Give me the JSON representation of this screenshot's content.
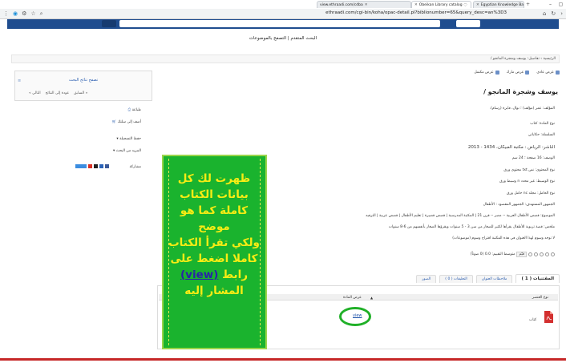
{
  "browser": {
    "tabs": [
      {
        "label": "view.ethraadi.com/cdba"
      },
      {
        "label": "Obeikan Library catalog"
      },
      {
        "label": "Egyptian Knowledge Ba"
      }
    ],
    "url": "ethraadi.com/cgi-bin/koha/opac-detail.pl?biblionumber=65&query_desc=an%3D3"
  },
  "header": {
    "advanced_links": "البحث المتقدم | التصفح بالموضوعات"
  },
  "breadcrumb": "الرئيسية › تفاصيل: يوسف وشجرة المانجو /",
  "toolbar": {
    "normal_view": "عرض عادي",
    "marc_view": "عرض مارك",
    "isbd_view": "عرض مكتمل"
  },
  "record": {
    "title": "يوسف وشجرة المانجو /",
    "author": "المؤلف: عمر (مؤلف) ؛ نوال، فايزة (رسام).",
    "material_type": "نوع المادة: كتاب",
    "series": "السلسلة: حكاياتي",
    "publisher": "الناشر: الرياض : مكتبة العبيكان، 1434 - 2013",
    "description": "الوصف: 16 صفحة ؛ 24 سم",
    "content_type": "نوع المحتوى: نص txt محتوى ورق",
    "media_type": "نوع الوسيط: غير محدد n وسيط ورق",
    "carrier_type": "نوع الحامل: مجلد nc حامل ورق",
    "audience": "الجمهور المستهدف: الجمهور المقصود : الأطفال",
    "subjects": "الموضوع: قصص الأطفال العربية -- مصر -- قرن 21 | المكتبة المدرسية | قصص قصيرة | تعليم الأطفال | قصص عربية | الترفيه",
    "summary": "ملخص: قصة تربوية للأطفال يقرأها لكثير للصغار من سن 3 - 5 سنوات ويقرؤها الصغار بأنفسهم من 6-8 سنوات",
    "tags": "لا توجد وسوم لهذا العنوان في هذه المكتبة   اقتراح وسوم (موضوعات)",
    "rating": "متوسط التقييم: 0.0 (0 صوتاً)",
    "rate_button": "قيّم"
  },
  "tabs": {
    "holdings": "المقتنيات ( 1 )",
    "title_notes": "ملاحظات العنوان",
    "comments": "التعليقات ( 0 )",
    "images": "الصور"
  },
  "holdings_table": {
    "col_item_type": "نوع العنصر",
    "col_material_view": "عرض المادة",
    "sort_marker": "▲",
    "rows": [
      {
        "item_type": "كتاب",
        "view": "view"
      }
    ]
  },
  "sidebar": {
    "heading": "تصفح نتائج البحث",
    "prev": "« السابق",
    "back": "عودة إلى النتائج",
    "next": "التالي »",
    "print": "طباعة",
    "add_cart": "أضف إلى سلتك",
    "save_record": "حفظ التسجيلة ▾",
    "more_search": "المزيد من البحث ▾",
    "share_label": "مشاركة"
  },
  "overlay": {
    "line1": "ظهرت لك كل",
    "line2": "بيانات الكتاب",
    "line3": "كاملة كما هو",
    "line4": "موضح",
    "line5": "ولكي تقرأ الكتاب",
    "line6": "كاملا اضغط على",
    "line7a": "رابط",
    "line7b": "(view)",
    "line8": "المشار إليه"
  },
  "colors": {
    "overlay_bg": "#1ab32e",
    "overlay_text": "#f7ec14",
    "highlight_ring": "#20b028",
    "header_bar": "#1f4d8f",
    "bottom_rule": "#c62828"
  }
}
